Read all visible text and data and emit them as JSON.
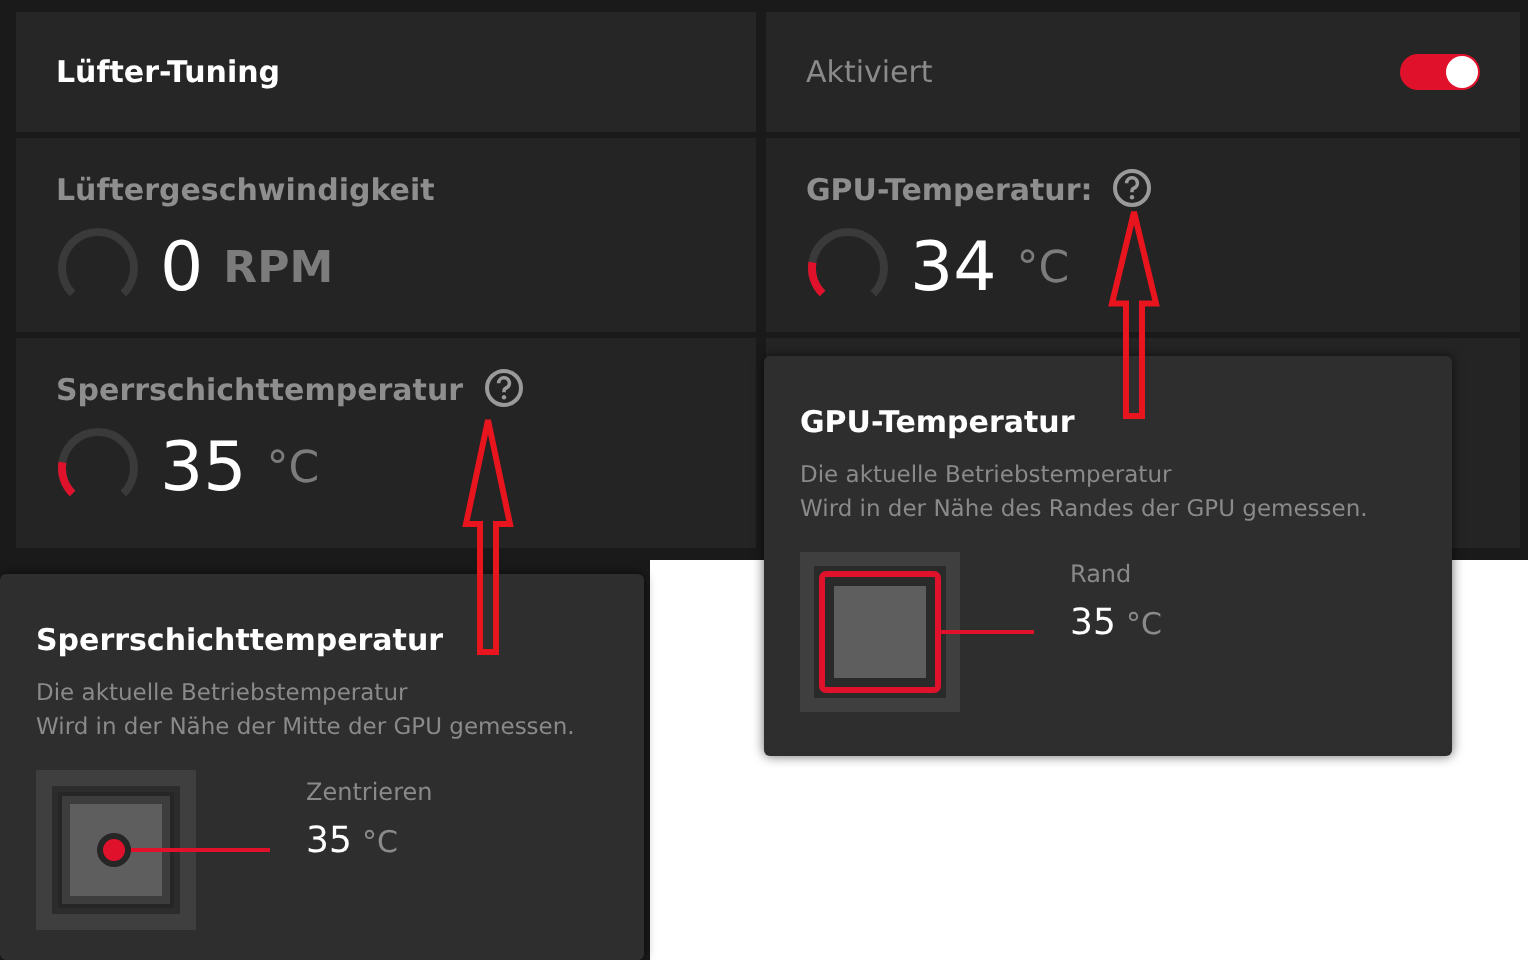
{
  "header": {
    "title": "Lüfter-Tuning",
    "status_label": "Aktiviert",
    "toggle_on": true
  },
  "metrics": [
    {
      "label": "Lüftergeschwindigkeit",
      "value": "0",
      "unit": "RPM",
      "level": 0,
      "help": false
    },
    {
      "label": "GPU-Temperatur:",
      "value": "34",
      "unit": "°C",
      "level": 0.2,
      "help": true
    },
    {
      "label": "Sperrschichttemperatur",
      "value": "35",
      "unit": "°C",
      "level": 0.2,
      "help": true
    }
  ],
  "tooltips": [
    {
      "kind": "center",
      "title": "Sperrschichttemperatur",
      "lines": [
        "Die aktuelle Betriebstemperatur",
        "Wird in der Nähe der Mitte der GPU gemessen."
      ],
      "sensor_label": "Zentrieren",
      "value": "35",
      "unit": "°C"
    },
    {
      "kind": "edge",
      "title": "GPU-Temperatur",
      "lines": [
        "Die aktuelle Betriebstemperatur",
        "Wird in der Nähe des Randes der GPU gemessen."
      ],
      "sensor_label": "Rand",
      "value": "35",
      "unit": "°C"
    }
  ]
}
